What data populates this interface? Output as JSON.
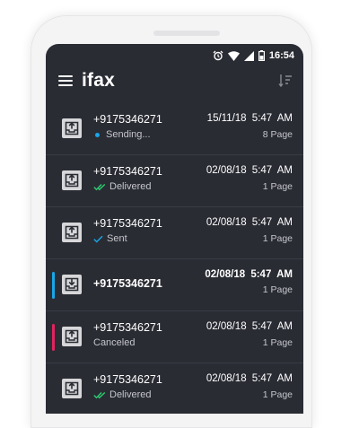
{
  "statusbar": {
    "time": "16:54"
  },
  "appbar": {
    "logo": "ifax"
  },
  "colors": {
    "screen_bg": "#2a2c34",
    "accent_blue": "#18a6e8",
    "canceled_red": "#e0245e",
    "delivered_green": "#2ecc71"
  },
  "faxes": [
    {
      "number": "+9175346271",
      "status": "Sending...",
      "status_icon": "dot-icon",
      "date": "15/11/18",
      "time": "5:47 AM",
      "pages": "8 Page",
      "unread": false,
      "marker": ""
    },
    {
      "number": "+9175346271",
      "status": "Delivered",
      "status_icon": "double-check-icon",
      "date": "02/08/18",
      "time": "5:47 AM",
      "pages": "1 Page",
      "unread": false,
      "marker": ""
    },
    {
      "number": "+9175346271",
      "status": "Sent",
      "status_icon": "check-icon",
      "date": "02/08/18",
      "time": "5:47 AM",
      "pages": "1 Page",
      "unread": false,
      "marker": ""
    },
    {
      "number": "+9175346271",
      "status": "",
      "status_icon": "",
      "date": "02/08/18",
      "time": "5:47 AM",
      "pages": "1 Page",
      "unread": true,
      "marker": "#18a6e8"
    },
    {
      "number": "+9175346271",
      "status": "Canceled",
      "status_icon": "",
      "date": "02/08/18",
      "time": "5:47 AM",
      "pages": "1 Page",
      "unread": false,
      "marker": "#e0245e"
    },
    {
      "number": "+9175346271",
      "status": "Delivered",
      "status_icon": "double-check-icon",
      "date": "02/08/18",
      "time": "5:47 AM",
      "pages": "1 Page",
      "unread": false,
      "marker": ""
    }
  ]
}
